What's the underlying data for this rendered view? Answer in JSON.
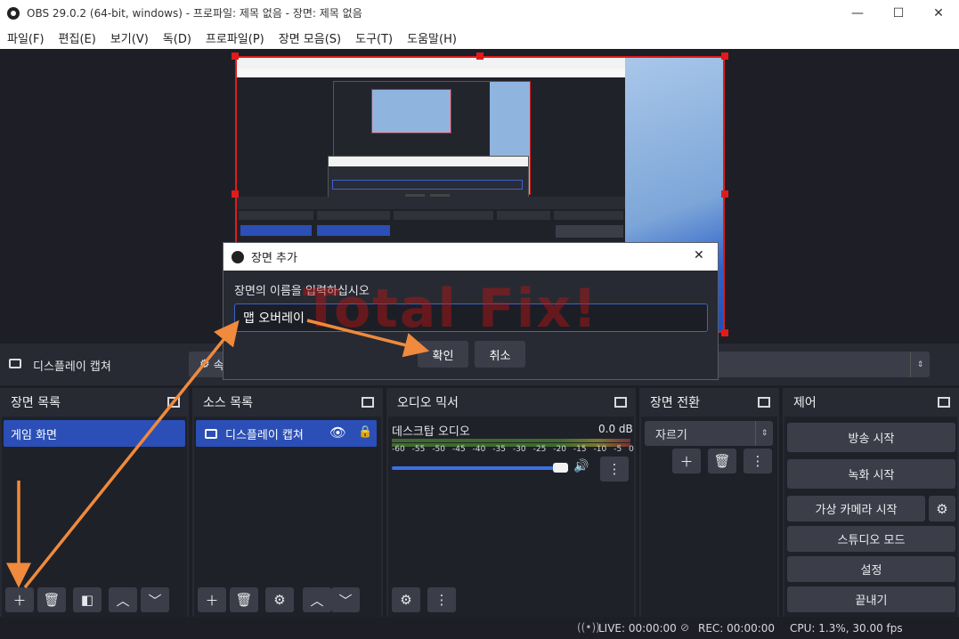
{
  "window": {
    "title": "OBS 29.0.2 (64-bit, windows) - 프로파일: 제목 없음 - 장면: 제목 없음",
    "minimize": "—",
    "maximize": "☐",
    "close": "✕"
  },
  "menu": [
    "파일(F)",
    "편집(E)",
    "보기(V)",
    "독(D)",
    "프로파일(P)",
    "장면 모음(S)",
    "도구(T)",
    "도움말(H)"
  ],
  "source_toolbar": {
    "source_name": "디스플레이 캡쳐",
    "properties_label": "속"
  },
  "dialog": {
    "title": "장면 추가",
    "prompt": "장면의 이름을 입력하십시오",
    "input_value": "맵 오버레이",
    "ok": "확인",
    "cancel": "취소",
    "close": "✕"
  },
  "docks": {
    "scenes": {
      "title": "장면 목록",
      "items": [
        "게임 화면"
      ]
    },
    "sources": {
      "title": "소스 목록",
      "items": [
        "디스플레이 캡쳐"
      ]
    },
    "mixer": {
      "title": "오디오 믹서",
      "channel": "데스크탑 오디오",
      "level": "0.0 dB",
      "scale": [
        "-60",
        "-55",
        "-50",
        "-45",
        "-40",
        "-35",
        "-30",
        "-25",
        "-20",
        "-15",
        "-10",
        "-5",
        "0"
      ],
      "volume": 0.9
    },
    "transitions": {
      "title": "장면 전환",
      "selected": "자르기"
    },
    "controls": {
      "title": "제어",
      "buttons": [
        "방송 시작",
        "녹화 시작",
        "가상 카메라 시작",
        "스튜디오 모드",
        "설정",
        "끝내기"
      ]
    }
  },
  "status": {
    "live": "LIVE: 00:00:00",
    "rec": "REC: 00:00:00",
    "cpu": "CPU: 1.3%, 30.00 fps"
  },
  "watermark": "Total Fix!",
  "colors": {
    "accent": "#2b4fb6",
    "selection": "#e01b1b",
    "annotation_arrow": "#f08a3c",
    "background": "#1e1f26",
    "panel": "#272a33"
  }
}
